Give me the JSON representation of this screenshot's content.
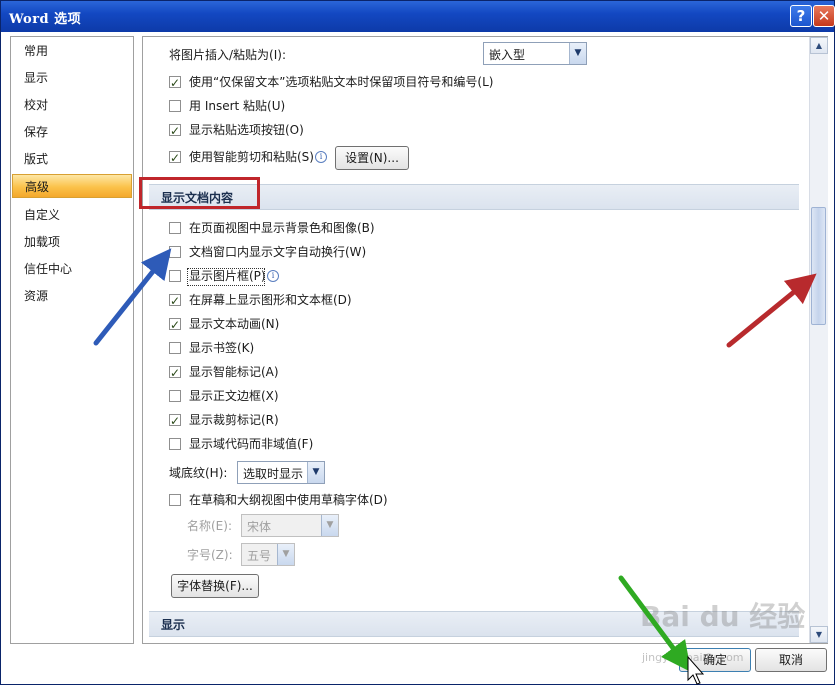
{
  "window": {
    "title": "Word 选项",
    "help_label": "?",
    "close_label": "✕"
  },
  "sidebar": {
    "items": [
      {
        "label": "常用"
      },
      {
        "label": "显示"
      },
      {
        "label": "校对"
      },
      {
        "label": "保存"
      },
      {
        "label": "版式"
      },
      {
        "label": "高级",
        "active": true
      },
      {
        "label": "自定义"
      },
      {
        "label": "加载项"
      },
      {
        "label": "信任中心"
      },
      {
        "label": "资源"
      }
    ]
  },
  "paste": {
    "insert_label": "将图片插入/粘贴为(I):",
    "insert_value": "嵌入型",
    "keep_text_label": "使用“仅保留文本”选项粘贴文本时保留项目符号和编号(L)",
    "insert_paste_label": "用 Insert 粘贴(U)",
    "show_paste_options_label": "显示粘贴选项按钮(O)",
    "smart_cut_label": "使用智能剪切和粘贴(S)",
    "settings_button": "设置(N)..."
  },
  "section_display_content": {
    "title": "显示文档内容",
    "options": [
      {
        "label": "在页面视图中显示背景色和图像(B)",
        "checked": false
      },
      {
        "label": "文档窗口内显示文字自动换行(W)",
        "checked": false
      },
      {
        "label": "显示图片框(P)",
        "checked": false
      },
      {
        "label": "在屏幕上显示图形和文本框(D)",
        "checked": true
      },
      {
        "label": "显示文本动画(N)",
        "checked": true
      },
      {
        "label": "显示书签(K)",
        "checked": false
      },
      {
        "label": "显示智能标记(A)",
        "checked": true
      },
      {
        "label": "显示正文边框(X)",
        "checked": false
      },
      {
        "label": "显示裁剪标记(R)",
        "checked": true
      },
      {
        "label": "显示域代码而非域值(F)",
        "checked": false
      }
    ],
    "field_shading_label": "域底纹(H):",
    "field_shading_value": "选取时显示",
    "draft_font_label": "在草稿和大纲视图中使用草稿字体(D)",
    "name_label": "名称(E):",
    "name_value": "宋体",
    "size_label": "字号(Z):",
    "size_value": "五号",
    "font_sub_button": "字体替换(F)..."
  },
  "section_display": {
    "title": "显示"
  },
  "footer": {
    "ok_label": "确定",
    "cancel_label": "取消"
  },
  "watermark": {
    "brand": "Bai du 经验",
    "url": "jingyan.baidu.com"
  }
}
